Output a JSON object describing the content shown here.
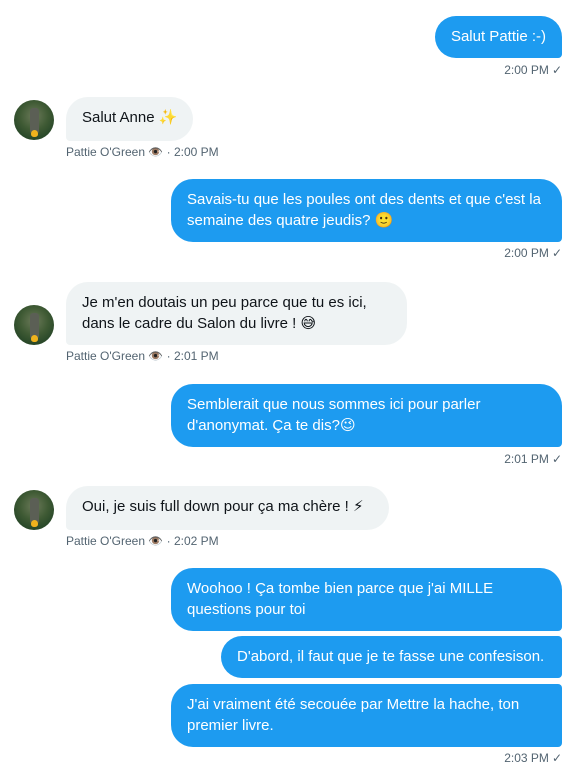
{
  "contact": {
    "name": "Pattie O'Green",
    "eye_emoji": "👁️"
  },
  "messages": [
    {
      "id": "m1",
      "side": "out",
      "text": "Salut Pattie :-)",
      "time": "2:00 PM",
      "check": "✓"
    },
    {
      "id": "m2",
      "side": "in",
      "text": "Salut Anne ✨",
      "time": "2:00 PM"
    },
    {
      "id": "m3",
      "side": "out",
      "line1": "Savais-tu que les poules ont des dents et que c'est la",
      "line2": "semaine des quatre jeudis? 🙂",
      "time": "2:00 PM",
      "check": "✓"
    },
    {
      "id": "m4",
      "side": "in",
      "line1": "Je m'en doutais un peu parce que tu es ici,",
      "line2": "dans le cadre du Salon du livre ! 😅",
      "time": "2:01 PM"
    },
    {
      "id": "m5",
      "side": "out",
      "line1": "Semblerait que nous sommes ici pour parler",
      "line2": "d'anonymat. Ça te dis?😉",
      "time": "2:01 PM",
      "check": "✓"
    },
    {
      "id": "m6",
      "side": "in",
      "text": "Oui, je suis full down pour ça ma chère ! ⚡",
      "time": "2:02 PM"
    },
    {
      "id": "m7",
      "side": "out",
      "line1": "Woohoo ! Ça tombe bien parce que j'ai MILLE",
      "line2": "questions pour toi"
    },
    {
      "id": "m8",
      "side": "out",
      "text": "D'abord, il faut que je te fasse une confesison."
    },
    {
      "id": "m9",
      "side": "out",
      "line1": "J'ai vraiment été secouée par Mettre la hache, ton",
      "line2": "premier livre.",
      "time": "2:03 PM",
      "check": "✓"
    }
  ],
  "meta_separator": "·"
}
